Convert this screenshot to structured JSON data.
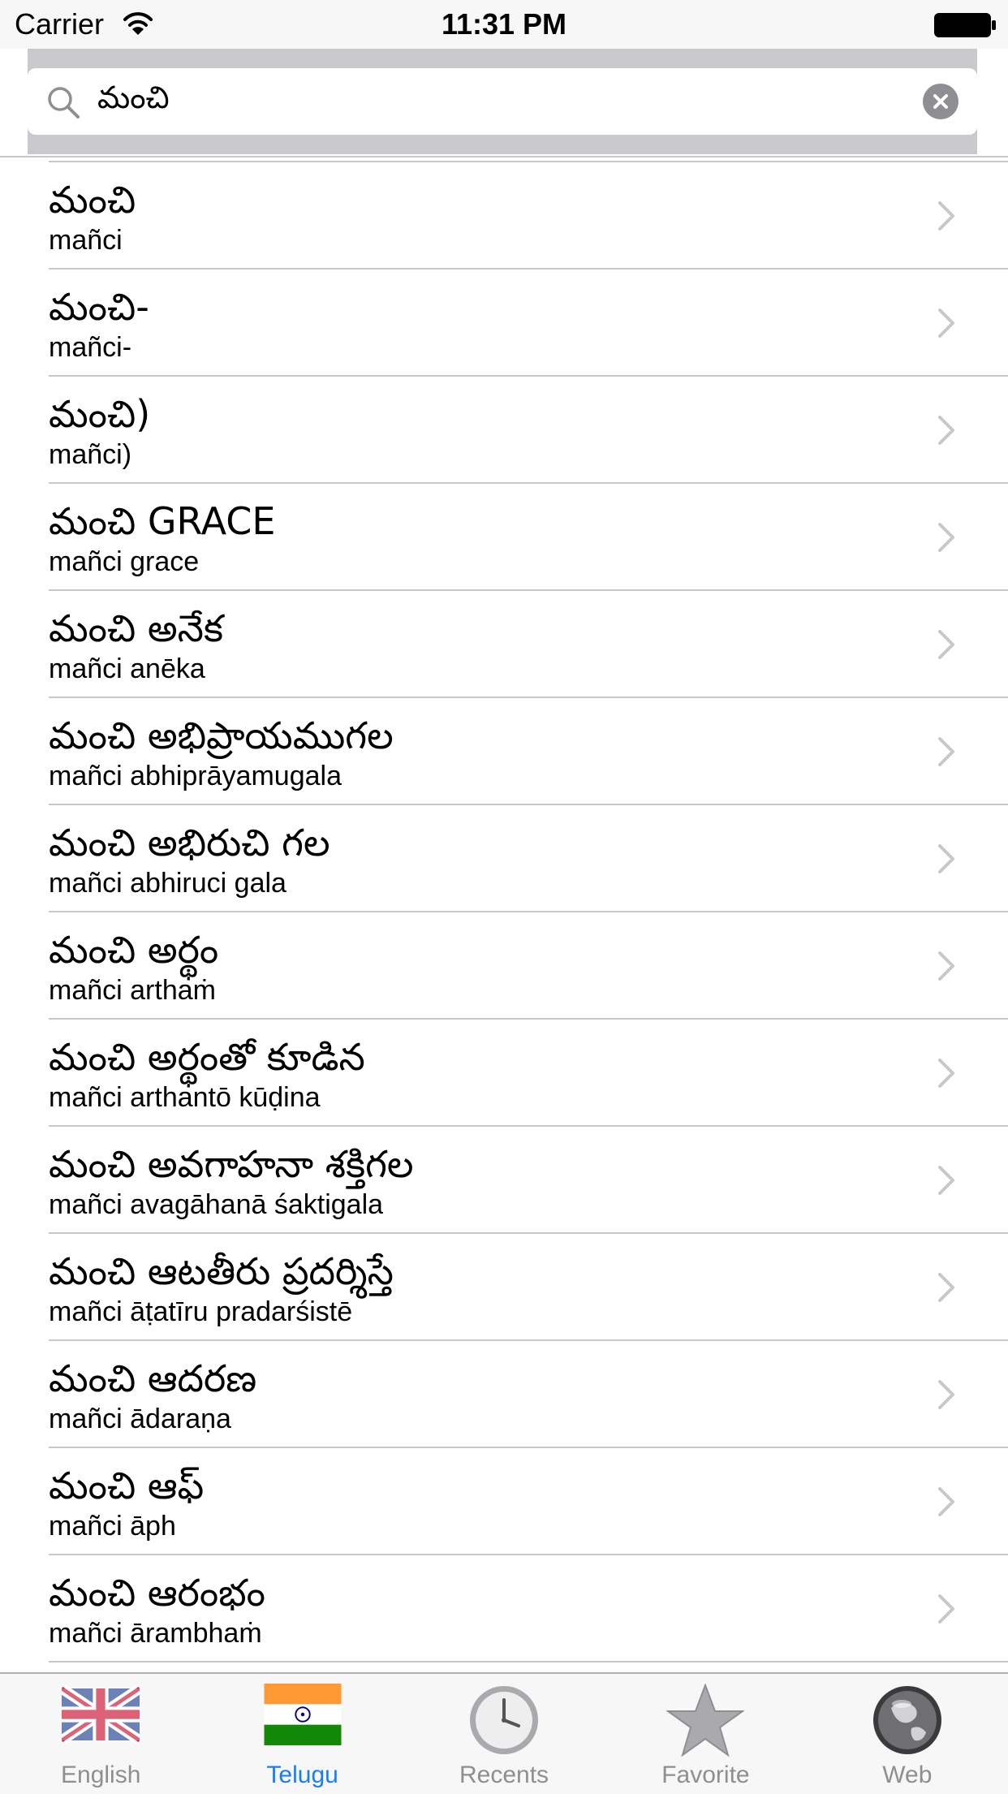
{
  "status_bar": {
    "carrier": "Carrier",
    "time": "11:31 PM"
  },
  "search": {
    "query": "మంచి"
  },
  "results": [
    {
      "telugu": "మంచి",
      "translit": "mañci"
    },
    {
      "telugu": "మంచి-",
      "translit": "mañci-"
    },
    {
      "telugu": "మంచి)",
      "translit": "mañci)"
    },
    {
      "telugu": "మంచి GRACE",
      "translit": "mañci grace"
    },
    {
      "telugu": "మంచి అనేక",
      "translit": "mañci anēka"
    },
    {
      "telugu": "మంచి అభిప్రాయముగల",
      "translit": "mañci abhiprāyamugala"
    },
    {
      "telugu": "మంచి అభిరుచి గల",
      "translit": "mañci abhiruci gala"
    },
    {
      "telugu": "మంచి అర్థం",
      "translit": "mañci arthaṁ"
    },
    {
      "telugu": "మంచి అర్థంతో కూడిన",
      "translit": "mañci arthantō kūḍina"
    },
    {
      "telugu": "మంచి అవగాహనా శక్తిగల",
      "translit": "mañci avagāhanā śaktigala"
    },
    {
      "telugu": "మంచి ఆటతీరు ప్రదర్శిస్తే",
      "translit": "mañci āṭatīru pradarśistē"
    },
    {
      "telugu": "మంచి ఆదరణ",
      "translit": "mañci ādaraṇa"
    },
    {
      "telugu": "మంచి ఆఫ్",
      "translit": "mañci āph"
    },
    {
      "telugu": "మంచి ఆరంభం",
      "translit": "mañci ārambhaṁ"
    }
  ],
  "tabs": [
    {
      "label": "English",
      "icon": "uk-flag-icon",
      "active": false
    },
    {
      "label": "Telugu",
      "icon": "india-flag-icon",
      "active": true
    },
    {
      "label": "Recents",
      "icon": "clock-icon",
      "active": false
    },
    {
      "label": "Favorite",
      "icon": "star-icon",
      "active": false
    },
    {
      "label": "Web",
      "icon": "globe-icon",
      "active": false
    }
  ],
  "colors": {
    "accent": "#1a7ef2",
    "inactive_tab": "#8e8e93",
    "separator": "#c8c7cc",
    "search_bg": "#c8c8cd"
  }
}
